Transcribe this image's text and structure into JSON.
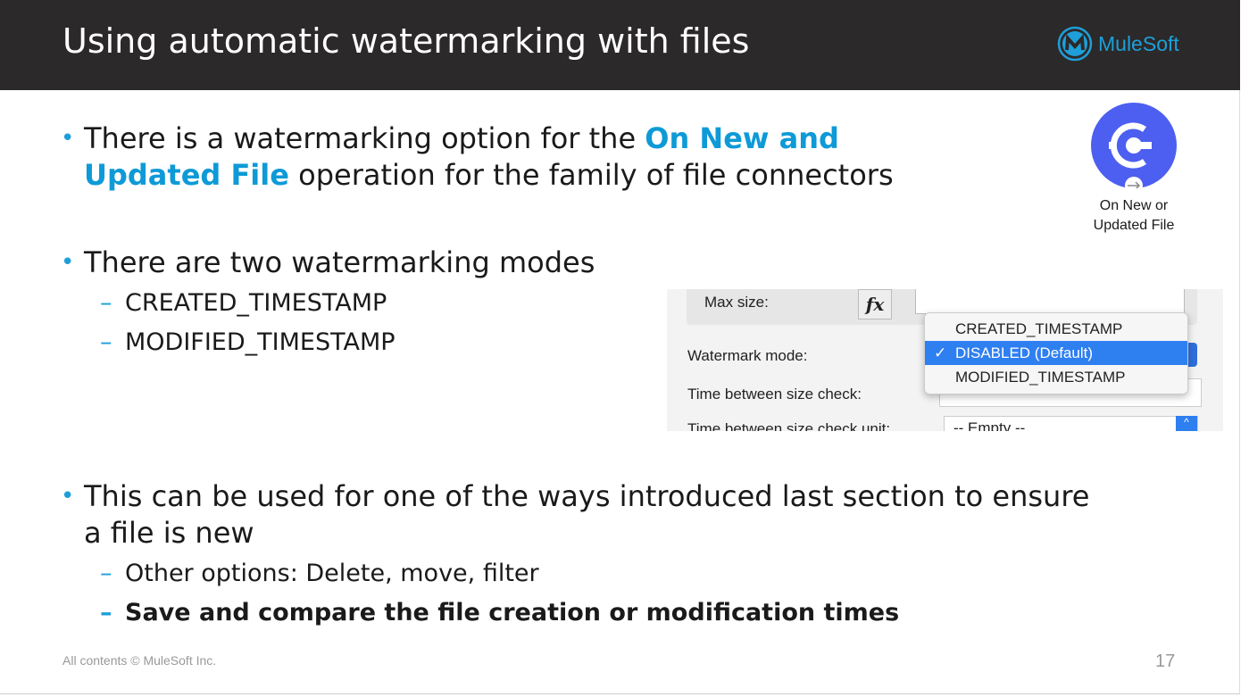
{
  "title": "Using automatic watermarking with files",
  "logo": {
    "text": "MuleSoft"
  },
  "bullets": {
    "b1_pre": "There is a watermarking option for the ",
    "b1_hl1": "On New and",
    "b1_hl2": "Updated File",
    "b1_post": " operation for the family of file connectors",
    "b2": "There are two watermarking modes",
    "b2_sub": [
      "CREATED_TIMESTAMP",
      "MODIFIED_TIMESTAMP"
    ],
    "b3_l1": "This can be used for one of the ways introduced last section to ensure",
    "b3_l2": "a file is new",
    "b3_sub1": "Other options: Delete, move, filter",
    "b3_sub2": "Save and compare the file creation or modification times"
  },
  "operation_icon": {
    "label1": "On New or",
    "label2": "Updated File",
    "color": "#4d5ff0"
  },
  "screenshot": {
    "max_size_label": "Max size:",
    "fx": "fx",
    "watermark_label": "Watermark mode:",
    "time_check_label": "Time between size check:",
    "time_unit_label": "Time between size check unit:",
    "time_unit_value": "-- Empty --",
    "options": [
      "CREATED_TIMESTAMP",
      "DISABLED (Default)",
      "MODIFIED_TIMESTAMP"
    ],
    "selected_index": 1
  },
  "footer": "All contents © MuleSoft Inc.",
  "page_number": "17"
}
